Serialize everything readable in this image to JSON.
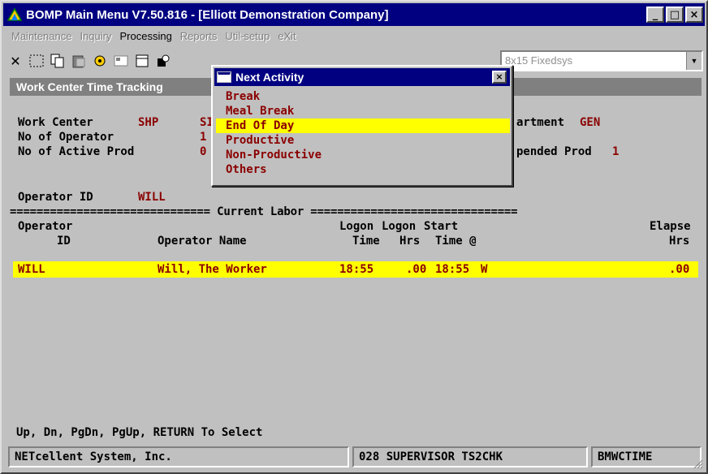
{
  "window": {
    "title": "BOMP Main Menu V7.50.816 - [Elliott Demonstration Company]",
    "buttons": {
      "minimize": "_",
      "maximize": "□",
      "close": "×"
    }
  },
  "menubar": {
    "items": [
      "Maintenance",
      "Inquiry",
      "Processing",
      "Reports",
      "Util-setup",
      "eXit"
    ]
  },
  "toolbar": {
    "font_value": "8x15 Fixedsys"
  },
  "screen": {
    "title": "Work Center Time Tracking",
    "work_center_label": "Work Center",
    "work_center_value": "SHP",
    "work_center_desc_partial": "SI",
    "department_label_partial": "artment",
    "department_value": "GEN",
    "operators_label": "No of Operator",
    "operators_value": "1",
    "active_prod_label": "No of Active Prod",
    "active_prod_value": "0",
    "suspended_label_partial": "pended Prod",
    "suspended_value": "1",
    "operator_id_label": "Operator ID",
    "operator_id_value": "WILL",
    "separator": "============================== Current Labor ===============================",
    "headers": {
      "row1": {
        "operator": "Operator",
        "logon": "Logon",
        "logon2": "Logon",
        "start": "Start",
        "elapse": "Elapse"
      },
      "row2": {
        "id": "ID",
        "name": "Operator Name",
        "time": "Time",
        "hrs": "Hrs",
        "time_at": "Time @",
        "hrs2": "Hrs"
      }
    },
    "rows": [
      {
        "id": "WILL",
        "name": "Will, The Worker",
        "logon_time": "18:55",
        "logon_hrs": ".00",
        "start_time": "18:55",
        "flag": "W",
        "elapse_hrs": ".00"
      }
    ],
    "prompt": "Up, Dn, PgDn, PgUp, RETURN To Select"
  },
  "popup": {
    "title": "Next Activity",
    "close": "×",
    "items": [
      "Break",
      "Meal Break",
      "End Of Day",
      "Productive",
      "Non-Productive",
      "Others"
    ],
    "selected_index": 2
  },
  "statusbar": {
    "company": "NETcellent System, Inc.",
    "user": "028 SUPERVISOR TS2CHK",
    "program": "BMWCTIME"
  },
  "colors": {
    "title_bg": "#000080",
    "highlight": "#ffff00",
    "value_red": "#8b0000",
    "face": "#c0c0c0"
  }
}
